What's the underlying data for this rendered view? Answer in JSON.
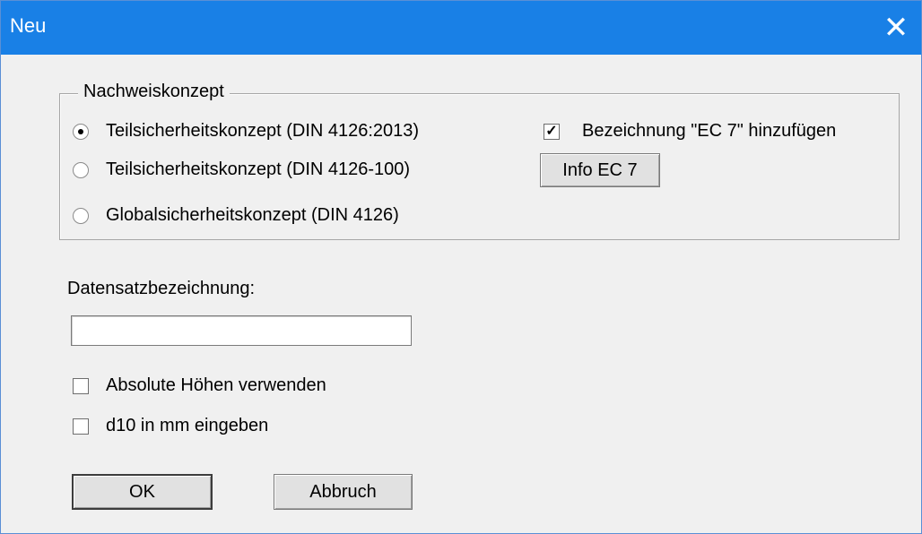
{
  "window": {
    "title": "Neu",
    "close_icon": "close-icon"
  },
  "group": {
    "legend": "Nachweiskonzept",
    "radios": [
      {
        "label": "Teilsicherheitskonzept (DIN 4126:2013)",
        "selected": true
      },
      {
        "label": "Teilsicherheitskonzept (DIN 4126-100)",
        "selected": false
      },
      {
        "label": "Globalsicherheitskonzept (DIN 4126)",
        "selected": false
      }
    ],
    "ec7_checkbox": {
      "label": "Bezeichnung \"EC 7\" hinzufügen",
      "checked": true
    },
    "info_button": "Info EC 7"
  },
  "dataset": {
    "label": "Datensatzbezeichnung:",
    "value": ""
  },
  "options": [
    {
      "label": "Absolute Höhen verwenden",
      "checked": false
    },
    {
      "label": "d10 in mm eingeben",
      "checked": false
    }
  ],
  "buttons": {
    "ok": "OK",
    "cancel": "Abbruch"
  }
}
